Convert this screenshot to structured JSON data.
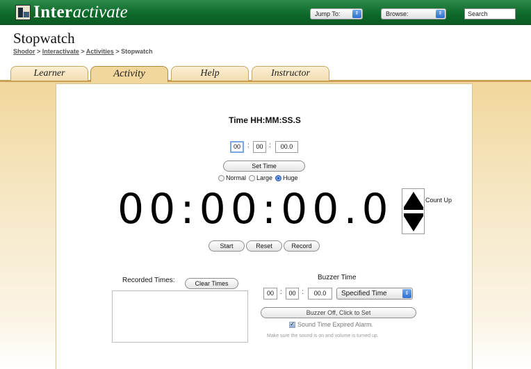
{
  "header": {
    "logo_bold": "Inter",
    "logo_italic": "activate",
    "jump_to": "Jump To:",
    "browse": "Browse:",
    "search": "Search"
  },
  "page": {
    "title": "Stopwatch",
    "breadcrumb": [
      "Shodor",
      "Interactivate",
      "Activities",
      "Stopwatch"
    ],
    "breadcrumb_sep": ">"
  },
  "tabs": [
    {
      "label": "Learner",
      "active": false
    },
    {
      "label": "Activity",
      "active": true
    },
    {
      "label": "Help",
      "active": false
    },
    {
      "label": "Instructor",
      "active": false
    }
  ],
  "stopwatch": {
    "heading": "Time HH:MM:SS.S",
    "hours": "00",
    "minutes": "00",
    "seconds": "00.0",
    "colon": ":",
    "set_time": "Set Time",
    "sizes": {
      "normal": "Normal",
      "large": "Large",
      "huge": "Huge",
      "selected": "huge"
    },
    "display": "00:00:00.0",
    "count_direction": "Count Up",
    "start": "Start",
    "reset": "Reset",
    "record": "Record"
  },
  "recorded": {
    "label": "Recorded Times:",
    "clear": "Clear Times"
  },
  "buzzer": {
    "label": "Buzzer Time",
    "hours": "00",
    "minutes": "00",
    "seconds": "00.0",
    "mode": "Specified Time",
    "toggle": "Buzzer Off, Click to Set",
    "alarm_label": "Sound Time Expired Alarm.",
    "alarm_checked": true,
    "note": "Make sure the sound is on and volume is turned up."
  }
}
